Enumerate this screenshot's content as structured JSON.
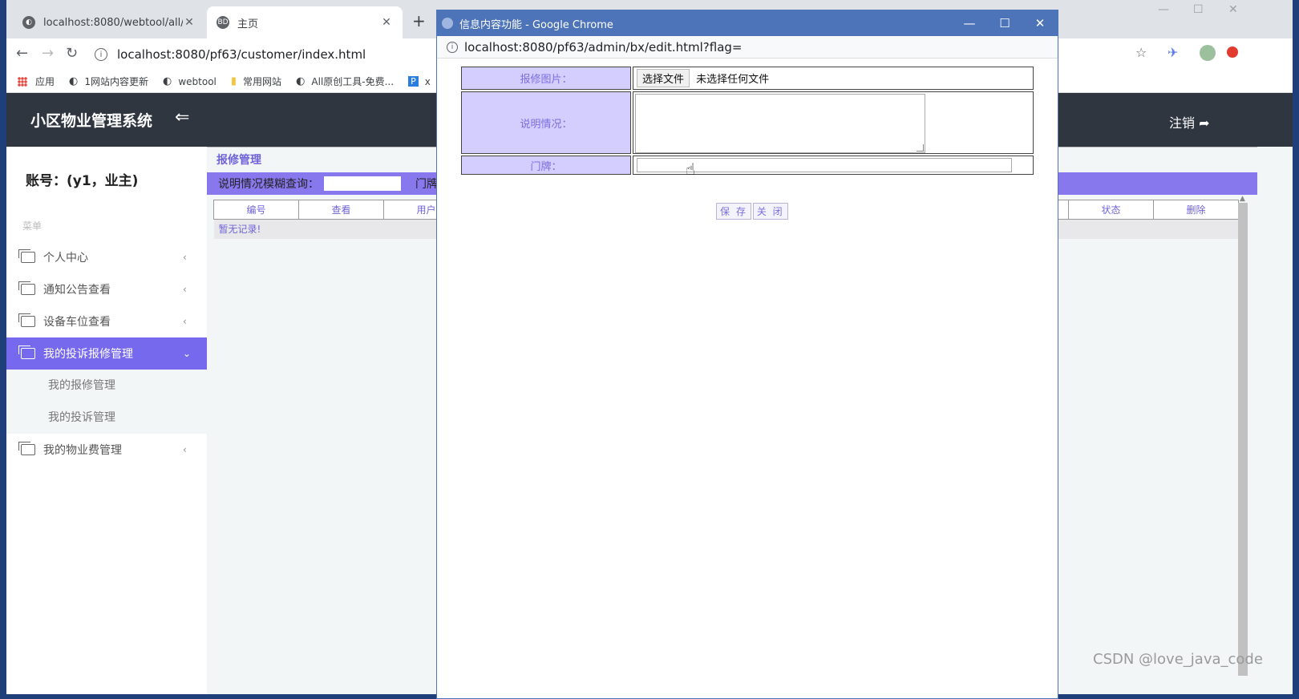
{
  "browser": {
    "tabs": [
      {
        "title": "localhost:8080/webtool/all/in",
        "icon": "globe-icon"
      },
      {
        "title": "主页",
        "icon": "bd-icon"
      }
    ],
    "favicon_bd": "BD",
    "new_tab": "+",
    "address": "localhost:8080/pf63/customer/index.html",
    "bookmarks": [
      {
        "label": "应用",
        "icon": "apps-grid-icon"
      },
      {
        "label": "1网站内容更新",
        "icon": "globe-icon"
      },
      {
        "label": "webtool",
        "icon": "globe-icon"
      },
      {
        "label": "常用网站",
        "icon": "folder-icon"
      },
      {
        "label": "All原创工具-免费...",
        "icon": "globe-icon"
      },
      {
        "label": "x",
        "icon": "p-icon"
      }
    ],
    "bookmark_p": "P"
  },
  "app": {
    "system_name": "小区物业管理系统",
    "logout_label": "注销",
    "account": "账号：(y1，业主)",
    "menu_caption": "菜单",
    "menu": [
      {
        "label": "个人中心"
      },
      {
        "label": "通知公告查看"
      },
      {
        "label": "设备车位查看"
      },
      {
        "label": "我的投诉报修管理"
      },
      {
        "label": "我的物业费管理"
      }
    ],
    "submenu": [
      {
        "label": "我的报修管理"
      },
      {
        "label": "我的投诉管理"
      }
    ]
  },
  "content": {
    "section_title": "报修管理",
    "search_label": "说明情况模糊查询：",
    "search_label2": "门牌",
    "columns": [
      "编号",
      "查看",
      "用户",
      "状态",
      "删除"
    ],
    "empty_text": "暂无记录!"
  },
  "popup": {
    "title": "信息内容功能 - Google Chrome",
    "address": "localhost:8080/pf63/admin/bx/edit.html?flag=",
    "fields": {
      "image_label": "报修图片：",
      "file_button": "选择文件",
      "file_note": "未选择任何文件",
      "desc_label": "说明情况：",
      "door_label": "门牌："
    },
    "save_label": "保 存",
    "close_label": "关 闭"
  },
  "watermark": "CSDN @love_java_code",
  "colors": {
    "accent": "#7769ee",
    "topbar": "#2f3640",
    "label_bg": "#d4ceff",
    "popup_title": "#4d74b8"
  }
}
